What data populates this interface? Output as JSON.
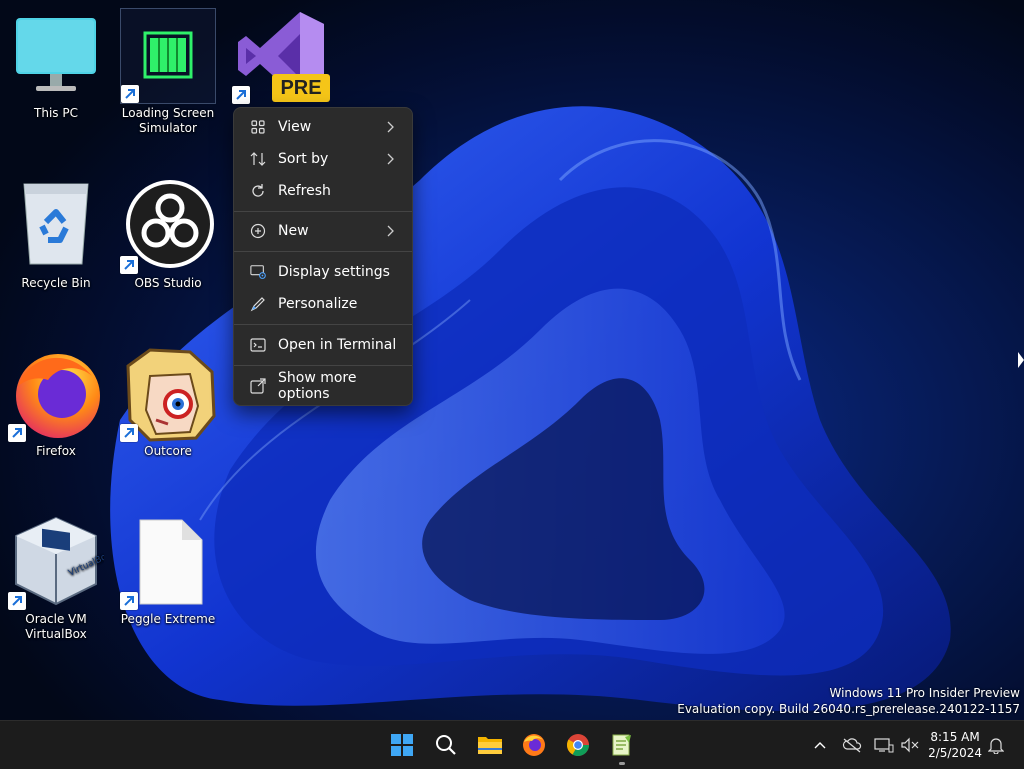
{
  "desktop": {
    "icons": [
      {
        "label": "This PC",
        "icon": "monitor-icon",
        "shortcut": false
      },
      {
        "label": "Loading Screen Simulator",
        "icon": "loading-bar-icon",
        "shortcut": true
      },
      {
        "label": "",
        "icon": "visual-studio-preview-icon",
        "badge": "PRE",
        "shortcut": true
      },
      {
        "label": "Recycle Bin",
        "icon": "recycle-bin-icon",
        "shortcut": false
      },
      {
        "label": "OBS Studio",
        "icon": "obs-icon",
        "shortcut": true
      },
      {
        "label": "Firefox",
        "icon": "firefox-icon",
        "shortcut": true
      },
      {
        "label": "Outcore",
        "icon": "outcore-character-icon",
        "shortcut": true
      },
      {
        "label": "Oracle VM VirtualBox",
        "icon": "virtualbox-icon",
        "shortcut": true
      },
      {
        "label": "Peggle Extreme",
        "icon": "blank-file-icon",
        "shortcut": true
      }
    ]
  },
  "context_menu": {
    "items": [
      {
        "label": "View",
        "icon": "grid-view-icon",
        "submenu": true
      },
      {
        "label": "Sort by",
        "icon": "sort-icon",
        "submenu": true
      },
      {
        "label": "Refresh",
        "icon": "refresh-icon",
        "submenu": false
      },
      {
        "label": "New",
        "icon": "plus-circle-icon",
        "submenu": true
      },
      {
        "label": "Display settings",
        "icon": "display-settings-icon",
        "submenu": false
      },
      {
        "label": "Personalize",
        "icon": "pen-icon",
        "submenu": false
      },
      {
        "label": "Open in Terminal",
        "icon": "terminal-icon",
        "submenu": false
      },
      {
        "label": "Show more options",
        "icon": "share-more-icon",
        "submenu": false
      }
    ]
  },
  "watermark": {
    "line1": "Windows 11 Pro Insider Preview",
    "line2": "Evaluation copy. Build 26040.rs_prerelease.240122-1157"
  },
  "taskbar": {
    "apps": [
      "start-icon",
      "search-icon",
      "file-explorer-icon",
      "firefox-icon",
      "chrome-icon",
      "notepad-plus-plus-icon"
    ],
    "clock": {
      "time": "8:15 AM",
      "date": "2/5/2024"
    }
  },
  "colors": {
    "accent": "#0078d4",
    "menu_bg": "#2b2b2b",
    "taskbar_bg": "#1c1c1c"
  }
}
